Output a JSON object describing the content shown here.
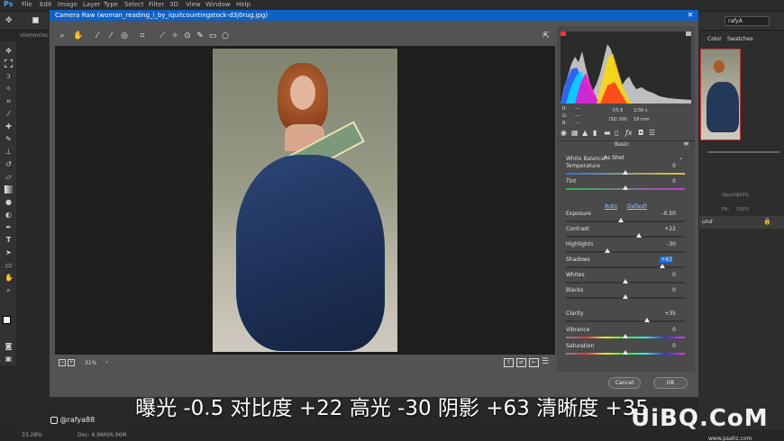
{
  "menubar": {
    "app_icon": "Ps",
    "items": [
      "File",
      "Edit",
      "Image",
      "Layer",
      "Type",
      "Select",
      "Filter",
      "3D",
      "View",
      "Window",
      "Help"
    ]
  },
  "doc_tab": "vlommclou",
  "right_panel": {
    "user": "rafyA",
    "tab_color": "Color",
    "tab_swatches": "Swatches",
    "layer_name": "und",
    "opacity_label": "Opacity:",
    "opacity_value": "100%",
    "fill_label": "Fill:",
    "fill_value": "100%"
  },
  "dialog": {
    "title": "Camera Raw (woman_reading_i_by_iquitcountingstock-d3j0rug.jpg)",
    "zoom": "31%",
    "cancel_label": "Cancel",
    "ok_label": "OK",
    "readout": {
      "r": "R:",
      "g": "G:",
      "b": "B:",
      "dash": "---",
      "aperture": "f/5.6",
      "shutter": "1/30 s",
      "iso": "ISO 200",
      "focal": "18 mm"
    },
    "panel_title": "Basic",
    "wb_label": "White Balance:",
    "wb_value": "As Shot",
    "auto_label": "Auto",
    "default_label": "Default",
    "sliders": [
      {
        "label": "Temperature",
        "value": "0",
        "pos": 0.5,
        "highlight": false
      },
      {
        "label": "Tint",
        "value": "0",
        "pos": 0.5,
        "highlight": false
      },
      {
        "label": "Exposure",
        "value": "-0.50",
        "pos": 0.46,
        "highlight": false
      },
      {
        "label": "Contrast",
        "value": "+22",
        "pos": 0.61,
        "highlight": false
      },
      {
        "label": "Highlights",
        "value": "-30",
        "pos": 0.35,
        "highlight": false
      },
      {
        "label": "Shadows",
        "value": "+63",
        "pos": 0.81,
        "highlight": true
      },
      {
        "label": "Whites",
        "value": "0",
        "pos": 0.5,
        "highlight": false
      },
      {
        "label": "Blacks",
        "value": "0",
        "pos": 0.5,
        "highlight": false
      },
      {
        "label": "Clarity",
        "value": "+35",
        "pos": 0.68,
        "highlight": false
      },
      {
        "label": "Vibrance",
        "value": "0",
        "pos": 0.5,
        "highlight": false
      },
      {
        "label": "Saturation",
        "value": "0",
        "pos": 0.5,
        "highlight": false
      }
    ]
  },
  "status": {
    "zoom": "33.28%",
    "doc": "Doc: 6.96M/6.96M"
  },
  "watermark": "@rafya88",
  "caption": "曝光 -0.5 对比度 +22 高光 -30 阴影 +63 清晰度 +35",
  "logo": "UiBQ.CoM",
  "logo_sub": "www.psahz.com",
  "colors": {
    "accent": "#0f62c5",
    "highlight": "#1473e6"
  }
}
